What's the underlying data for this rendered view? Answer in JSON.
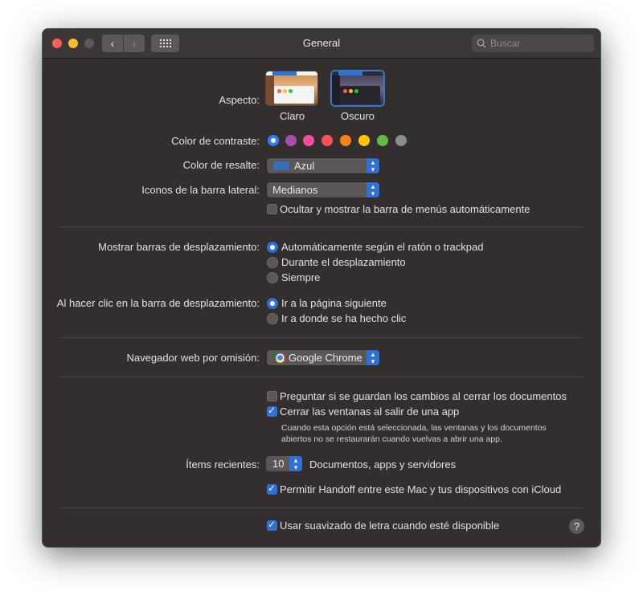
{
  "window": {
    "title": "General",
    "search_placeholder": "Buscar",
    "nav_back": "‹",
    "nav_forward": "›"
  },
  "appearance": {
    "label": "Aspecto:",
    "options": [
      {
        "label": "Claro",
        "selected": false
      },
      {
        "label": "Oscuro",
        "selected": true
      }
    ]
  },
  "accent_color": {
    "label": "Color de contraste:",
    "swatches": [
      {
        "name": "azul",
        "color": "#2f7cf6",
        "selected": true
      },
      {
        "name": "morado",
        "color": "#a550a7",
        "selected": false
      },
      {
        "name": "rosa",
        "color": "#f74f9e",
        "selected": false
      },
      {
        "name": "rojo",
        "color": "#ff5257",
        "selected": false
      },
      {
        "name": "naranja",
        "color": "#f7821b",
        "selected": false
      },
      {
        "name": "amarillo",
        "color": "#ffc600",
        "selected": false
      },
      {
        "name": "verde",
        "color": "#62ba46",
        "selected": false
      },
      {
        "name": "grafito",
        "color": "#8c8c8c",
        "selected": false
      }
    ]
  },
  "highlight_color": {
    "label": "Color de resalte:",
    "value": "Azul"
  },
  "sidebar_icons": {
    "label": "Iconos de la barra lateral:",
    "value": "Medianos"
  },
  "menu_bar": {
    "label": "Ocultar y mostrar la barra de menús automáticamente",
    "checked": false
  },
  "scroll_bars": {
    "label": "Mostrar barras de desplazamiento:",
    "options": [
      {
        "label": "Automáticamente según el ratón o trackpad",
        "selected": true
      },
      {
        "label": "Durante el desplazamiento",
        "selected": false
      },
      {
        "label": "Siempre",
        "selected": false
      }
    ]
  },
  "scroll_click": {
    "label": "Al hacer clic en la barra de desplazamiento:",
    "options": [
      {
        "label": "Ir a la página siguiente",
        "selected": true
      },
      {
        "label": "Ir a donde se ha hecho clic",
        "selected": false
      }
    ]
  },
  "browser": {
    "label": "Navegador web por omisión:",
    "value": "Google Chrome"
  },
  "documents": {
    "ask_save": {
      "label": "Preguntar si se guardan los cambios al cerrar los documentos",
      "checked": false
    },
    "close_windows": {
      "label": "Cerrar las ventanas al salir de una app",
      "checked": true
    },
    "note_line1": "Cuando esta opción está seleccionada, las ventanas y los documentos",
    "note_line2": "abiertos no se restaurarán cuando vuelvas a abrir una app."
  },
  "recent_items": {
    "label": "Ítems recientes:",
    "value": "10",
    "suffix": "Documentos, apps y servidores"
  },
  "handoff": {
    "label": "Permitir Handoff entre este Mac y tus dispositivos con iCloud",
    "checked": true
  },
  "font_smoothing": {
    "label": "Usar suavizado de letra cuando esté disponible",
    "checked": true
  },
  "help_label": "?"
}
